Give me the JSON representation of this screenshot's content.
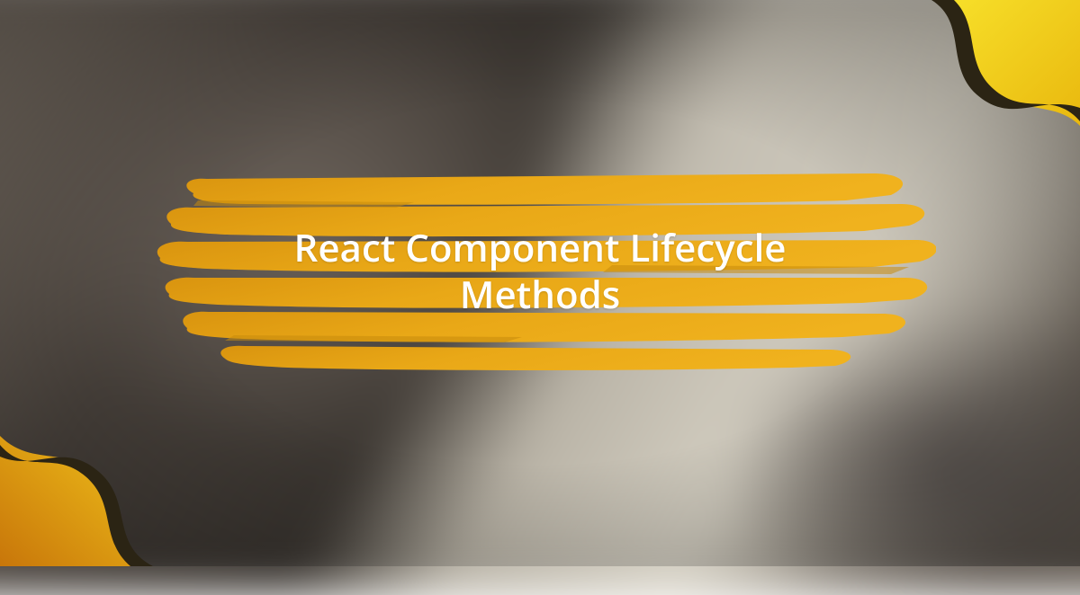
{
  "banner": {
    "title": "React Component Lifecycle Methods"
  },
  "colors": {
    "brush_primary": "#e6a417",
    "brush_dark": "#c98a0e",
    "brush_light": "#f2b93a",
    "accent_yellow": "#f5d412",
    "accent_orange": "#d97b0a",
    "accent_dark": "#3a2a15",
    "text": "#ffffff"
  }
}
